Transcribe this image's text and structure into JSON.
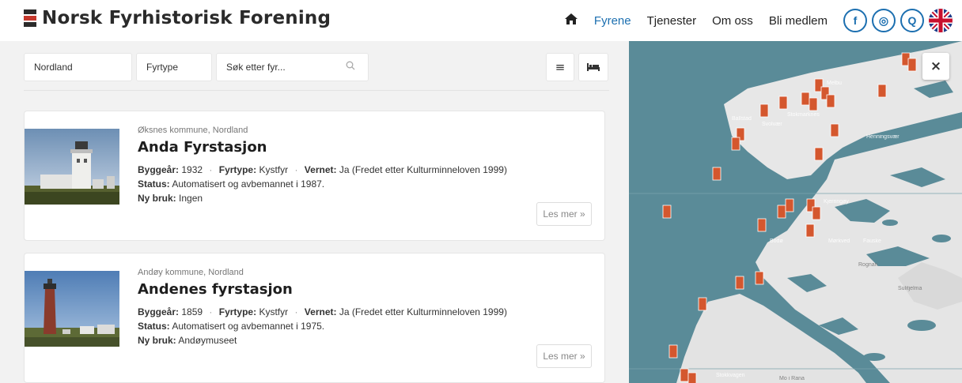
{
  "header": {
    "site_title": "Norsk Fyrhistorisk Forening",
    "nav": {
      "home_icon": "home-icon",
      "items": [
        "Fyrene",
        "Tjenester",
        "Om oss",
        "Bli medlem"
      ],
      "active": "Fyrene"
    },
    "social": {
      "facebook": "f",
      "instagram": "◎",
      "search": "Q"
    }
  },
  "filters": {
    "region": "Nordland",
    "type": "Fyrtype",
    "search_placeholder": "Søk etter fyr...",
    "list_view_icon": "≡",
    "bed_icon": "bed-icon"
  },
  "cards": [
    {
      "municipality": "Øksnes kommune, Nordland",
      "title": "Anda Fyrstasjon",
      "year_label": "Byggeår:",
      "year": "1932",
      "type_label": "Fyrtype:",
      "type": "Kystfyr",
      "protected_label": "Vernet:",
      "protected": "Ja (Fredet etter Kulturminneloven 1999)",
      "status_label": "Status:",
      "status": "Automatisert og avbemannet i 1987.",
      "use_label": "Ny bruk:",
      "use": "Ingen",
      "more": "Les mer »"
    },
    {
      "municipality": "Andøy kommune, Nordland",
      "title": "Andenes fyrstasjon",
      "year_label": "Byggeår:",
      "year": "1859",
      "type_label": "Fyrtype:",
      "type": "Kystfyr",
      "protected_label": "Vernet:",
      "protected": "Ja (Fredet etter Kulturminneloven 1999)",
      "status_label": "Status:",
      "status": "Automatisert og avbemannet i 1975.",
      "use_label": "Ny bruk:",
      "use": "Andøymuseet",
      "more": "Les mer »"
    }
  ],
  "map": {
    "close": "×",
    "labels": [
      "Melbu",
      "Stokmarknes",
      "Bodø",
      "Mørkved",
      "Fauske",
      "Rognan",
      "Kjerringøy",
      "Stokkvagen",
      "Mo i Rana",
      "Svolvær",
      "Henningsvær",
      "Ballstad",
      "Sulitjelma"
    ]
  }
}
